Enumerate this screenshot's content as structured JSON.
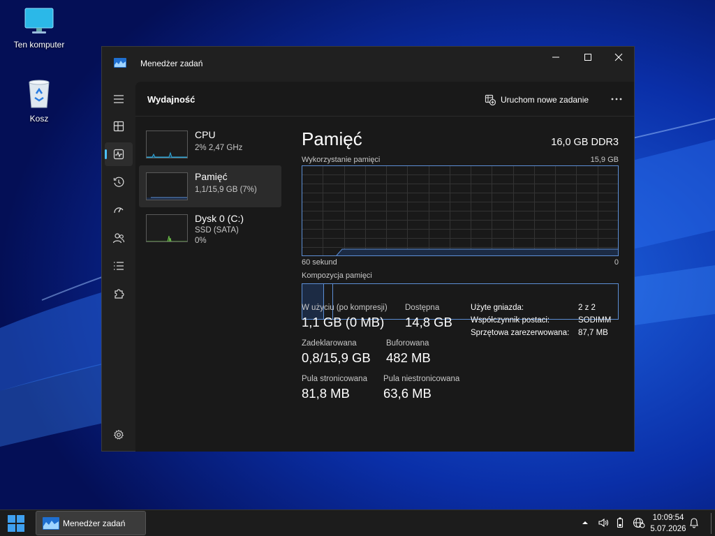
{
  "desktop": {
    "icons": [
      {
        "label": "Ten komputer",
        "icon": "monitor-icon"
      },
      {
        "label": "Kosz",
        "icon": "recycle-bin-icon"
      }
    ]
  },
  "window": {
    "title": "Menedżer zadań",
    "controls": [
      "minimize",
      "maximize",
      "close"
    ]
  },
  "nav": {
    "items": [
      "menu",
      "processes",
      "performance",
      "app-history",
      "startup-apps",
      "users",
      "details",
      "services",
      "settings"
    ],
    "active": "performance"
  },
  "header": {
    "title": "Wydajność",
    "run_task_label": "Uruchom nowe zadanie",
    "more_label": "..."
  },
  "resources": [
    {
      "name": "CPU",
      "sub1": "2% 2,47 GHz",
      "sub2": "",
      "color": "#2fa6d8",
      "selected": false
    },
    {
      "name": "Pamięć",
      "sub1": "1,1/15,9 GB (7%)",
      "sub2": "",
      "color": "#5d8fd6",
      "selected": true
    },
    {
      "name": "Dysk 0 (C:)",
      "sub1": "SSD (SATA)",
      "sub2": "0%",
      "color": "#6cc04a",
      "selected": false
    }
  ],
  "detail": {
    "title": "Pamięć",
    "spec": "16,0 GB DDR3",
    "usage_label": "Wykorzystanie pamięci",
    "usage_max": "15,9 GB",
    "axis_left": "60 sekund",
    "axis_right": "0",
    "composition_label": "Kompozycja pamięci",
    "composition": {
      "in_use_fraction": 0.069,
      "modified_fraction": 0.004
    },
    "graph_usage_fraction": 0.07,
    "stats": [
      {
        "label": "W użyciu (po kompresji)",
        "value": "1,1 GB (0 MB)"
      },
      {
        "label": "Dostępna",
        "value": "14,8 GB"
      },
      {
        "label": "Zadeklarowana",
        "value": "0,8/15,9 GB"
      },
      {
        "label": "Buforowana",
        "value": "482 MB"
      },
      {
        "label": "Pula stronicowana",
        "value": "81,8 MB"
      },
      {
        "label": "Pula niestronicowana",
        "value": "63,6 MB"
      }
    ],
    "props": [
      {
        "key": "Użyte gniazda:",
        "value": "2 z 2"
      },
      {
        "key": "Współczynnik postaci:",
        "value": "SODIMM"
      },
      {
        "key": "Sprzętowa zarezerwowana:",
        "value": "87,7 MB"
      }
    ]
  },
  "taskbar": {
    "app_label": "Menedżer zadań",
    "time": "10:09:54",
    "date": "5.07.2026",
    "tray_icons": [
      "chevron-up-icon",
      "volume-icon",
      "battery-icon",
      "network-icon",
      "globe-icon",
      "notification-bell-icon"
    ]
  },
  "colors": {
    "accent": "#4cc2ff",
    "memory": "#5d8fd6",
    "cpu": "#2fa6d8",
    "disk": "#6cc04a",
    "window_bg": "#202020",
    "content_bg": "#191919"
  }
}
